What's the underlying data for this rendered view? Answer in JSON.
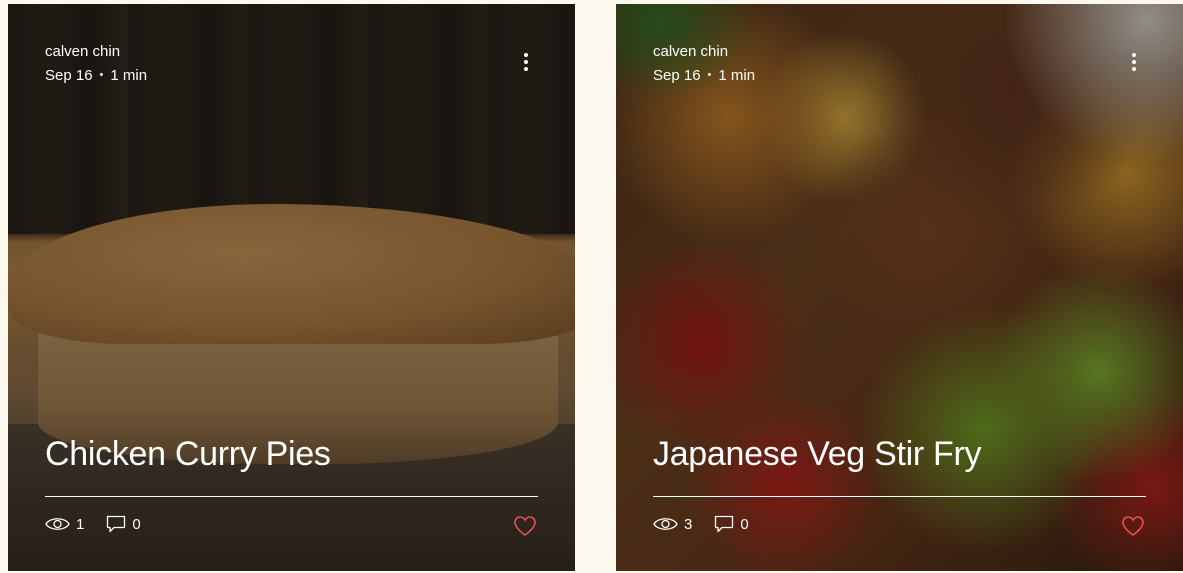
{
  "posts": [
    {
      "author": "calven chin",
      "date": "Sep 16",
      "separator": "•",
      "read_time": "1 min",
      "title": "Chicken Curry Pies",
      "views": "1",
      "comments": "0",
      "image_subject": "chicken curry pie"
    },
    {
      "author": "calven chin",
      "date": "Sep 16",
      "separator": "•",
      "read_time": "1 min",
      "title": "Japanese Veg Stir Fry",
      "views": "3",
      "comments": "0",
      "image_subject": "vegetable stir fry"
    }
  ],
  "icons": {
    "more": "more-vertical-icon",
    "views": "eye-icon",
    "comments": "comment-icon",
    "like": "heart-icon"
  },
  "colors": {
    "page_background": "#fdf8ee",
    "text": "#ffffff",
    "like_heart": "#e8514f"
  }
}
